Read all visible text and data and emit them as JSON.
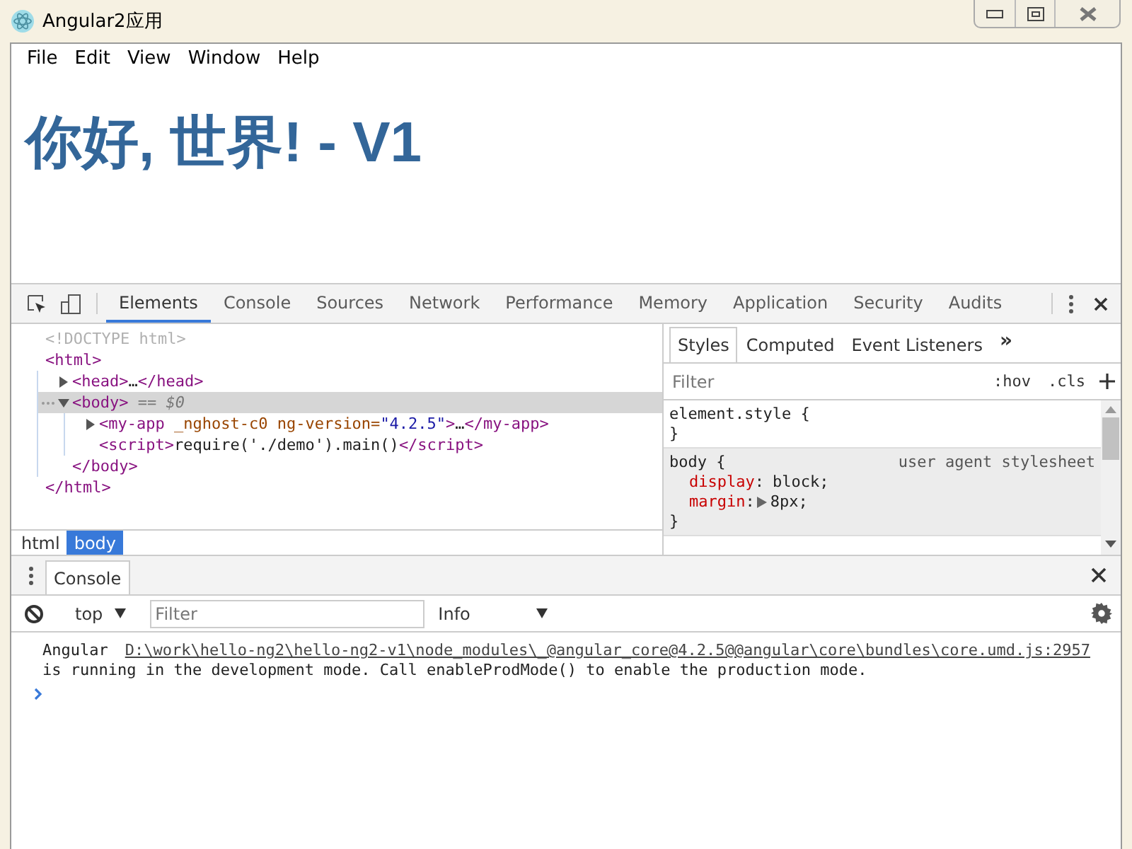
{
  "window": {
    "title": "Angular2应用"
  },
  "menu": [
    "File",
    "Edit",
    "View",
    "Window",
    "Help"
  ],
  "heading": "你好, 世界! - V1",
  "devtools": {
    "tabs": [
      {
        "label": "Elements",
        "selected": true
      },
      {
        "label": "Console",
        "selected": false
      },
      {
        "label": "Sources",
        "selected": false
      },
      {
        "label": "Network",
        "selected": false
      },
      {
        "label": "Performance",
        "selected": false
      },
      {
        "label": "Memory",
        "selected": false
      },
      {
        "label": "Application",
        "selected": false
      },
      {
        "label": "Security",
        "selected": false
      },
      {
        "label": "Audits",
        "selected": false
      }
    ],
    "dom": [
      {
        "selected": false,
        "line": [
          {
            "kind": "doctype",
            "text": "<!DOCTYPE html>"
          }
        ]
      },
      {
        "selected": false,
        "line": [
          {
            "kind": "tag",
            "text": "<html>"
          }
        ],
        "closing": [
          {
            "kind": "tag",
            "text": "</html>"
          }
        ],
        "children": [
          {
            "expanded": false,
            "selected": false,
            "line": [
              {
                "kind": "tag",
                "text": "<head>"
              },
              {
                "kind": "text",
                "text": "…"
              },
              {
                "kind": "tag",
                "text": "</head>"
              }
            ]
          },
          {
            "expanded": true,
            "selected": true,
            "line": [
              {
                "kind": "tag",
                "text": "<body>"
              },
              {
                "kind": "hint",
                "text": " == $0"
              }
            ],
            "closing": [
              {
                "kind": "tag",
                "text": "</body>"
              }
            ],
            "children": [
              {
                "expanded": false,
                "selected": false,
                "line": [
                  {
                    "kind": "tag",
                    "text": "<my-app"
                  },
                  {
                    "kind": "attr",
                    "text": " _nghost-c0 ng-version="
                  },
                  {
                    "kind": "value",
                    "text": "\"4.2.5\""
                  },
                  {
                    "kind": "tag",
                    "text": ">"
                  },
                  {
                    "kind": "text",
                    "text": "…"
                  },
                  {
                    "kind": "tag",
                    "text": "</my-app>"
                  }
                ]
              },
              {
                "selected": false,
                "line": [
                  {
                    "kind": "tag",
                    "text": "<script>"
                  },
                  {
                    "kind": "text",
                    "text": "require('./demo').main()"
                  },
                  {
                    "kind": "tag",
                    "text": "</script>"
                  }
                ]
              }
            ]
          }
        ]
      }
    ],
    "breadcrumbs": [
      {
        "label": "html",
        "selected": false
      },
      {
        "label": "body",
        "selected": true
      }
    ],
    "styles_tabs": [
      {
        "label": "Styles",
        "selected": true
      },
      {
        "label": "Computed",
        "selected": false
      },
      {
        "label": "Event Listeners",
        "selected": false
      }
    ],
    "styles_more": "»",
    "styles_filter": {
      "placeholder": "Filter"
    },
    "hov": ":hov",
    "cls": ".cls",
    "rules": [
      {
        "kind": "inline",
        "header": "element.style {",
        "close": "}"
      },
      {
        "kind": "user-agent",
        "header": "body {",
        "origin": "user agent stylesheet",
        "close": "}",
        "properties": [
          {
            "name": "display",
            "sep": ":",
            "value": "block;",
            "expandable": false
          },
          {
            "name": "margin",
            "sep": ":",
            "value": "8px;",
            "expandable": true
          }
        ]
      }
    ]
  },
  "drawer": {
    "tabs": [
      {
        "label": "Console",
        "selected": true
      }
    ],
    "context": "top",
    "filter": {
      "placeholder": "Filter"
    },
    "level": "Info",
    "messages": [
      {
        "source": "Angular",
        "link": "D:\\work\\hello-ng2\\hello-ng2-v1\\node_modules\\_@angular_core@4.2.5@@angular\\core\\bundles\\core.umd.js:2957",
        "text": "is running in the development mode. Call enableProdMode() to enable the production mode."
      }
    ]
  }
}
